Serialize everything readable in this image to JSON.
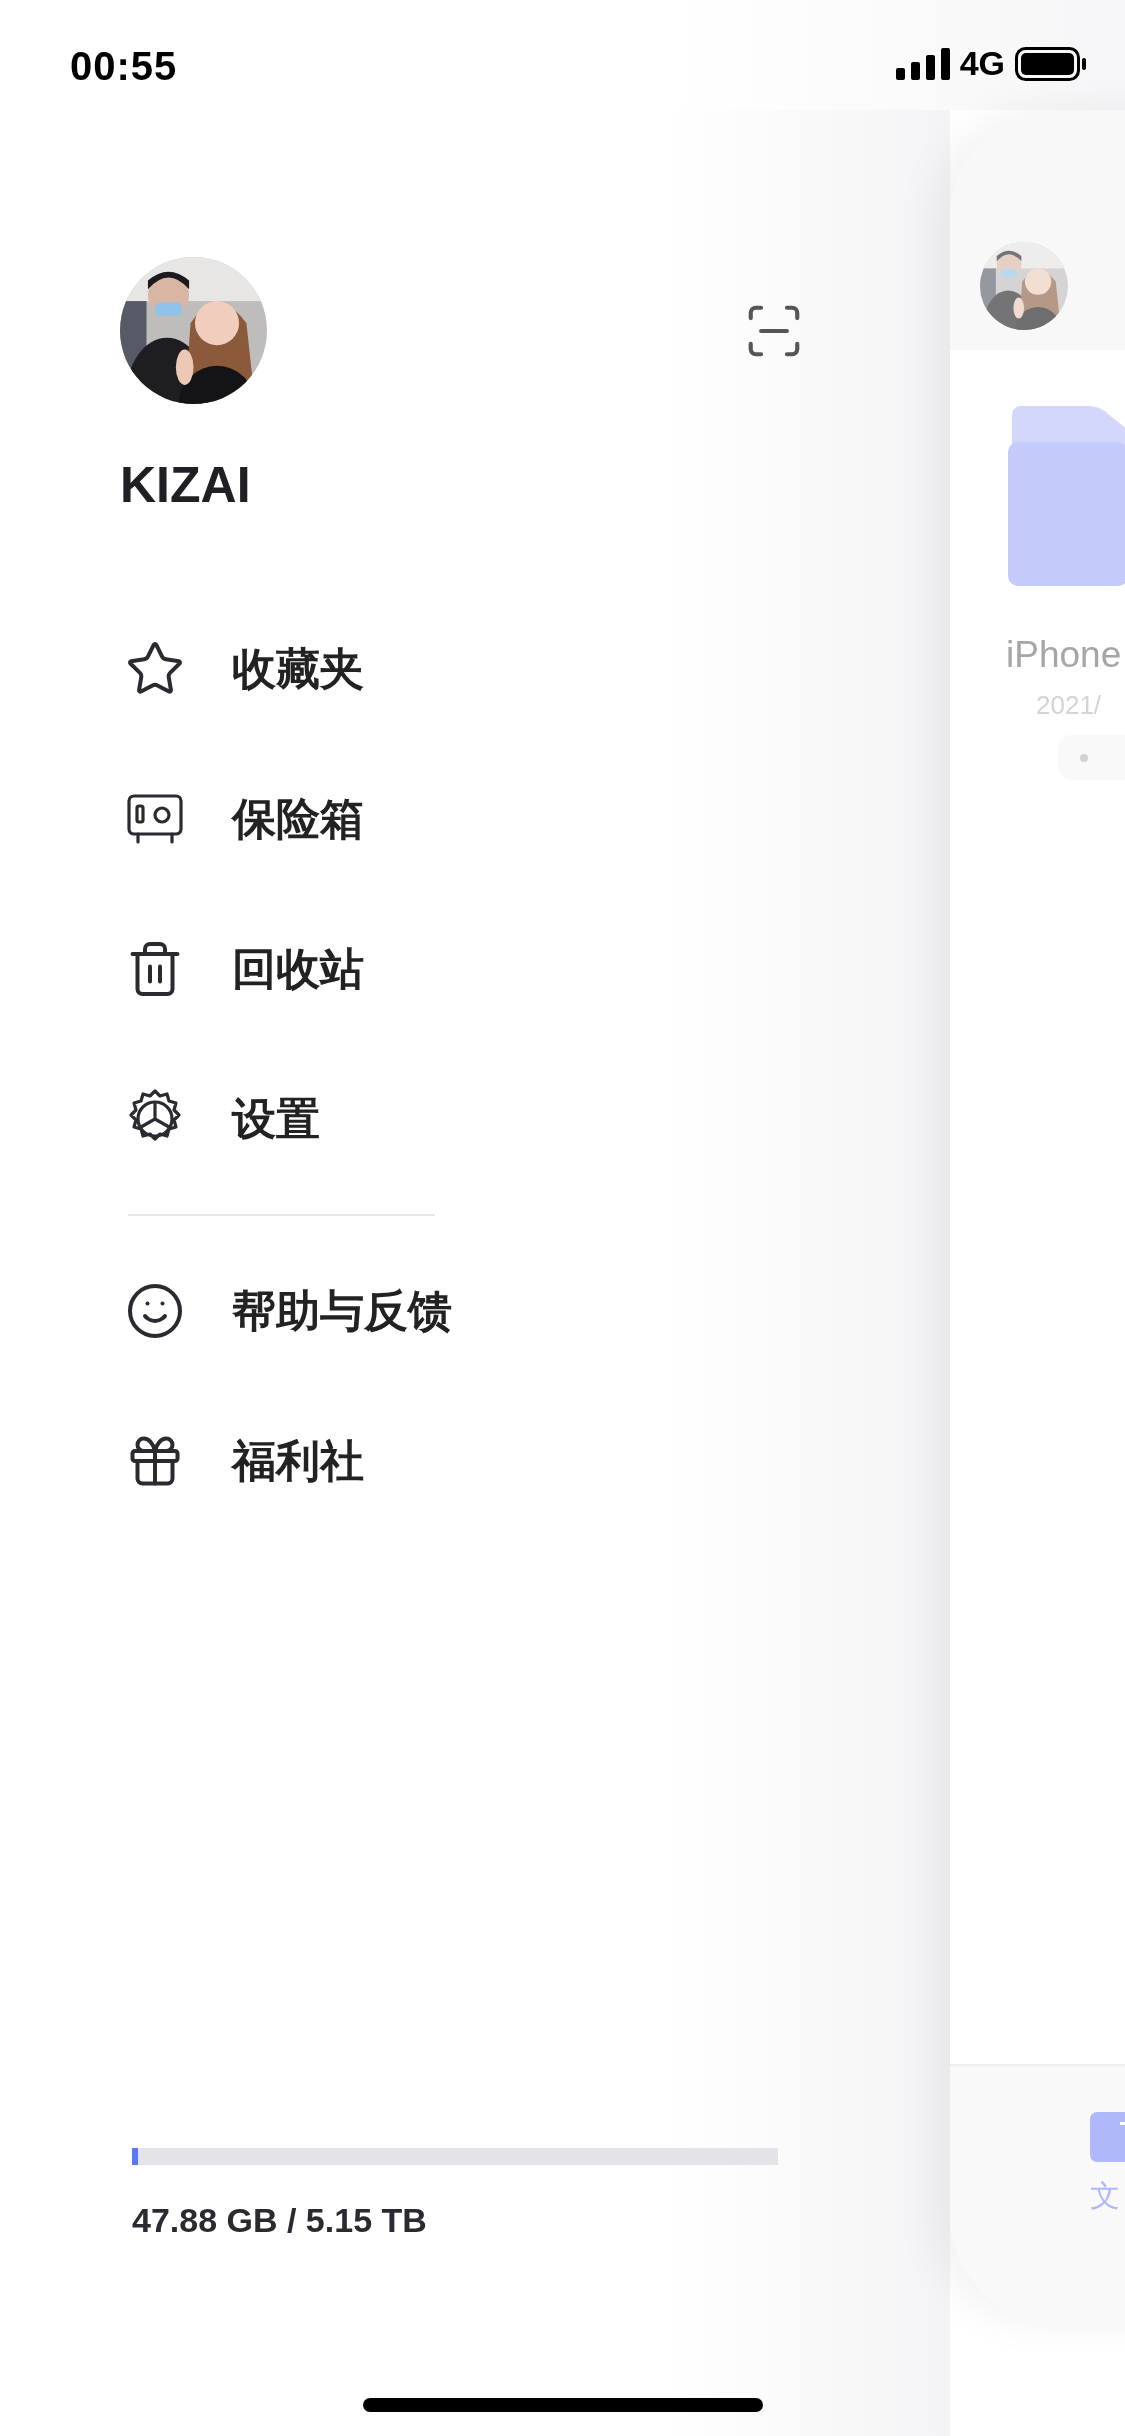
{
  "status_bar": {
    "time": "00:55",
    "network": "4G"
  },
  "profile": {
    "name": "KIZAI"
  },
  "menu_groups": [
    [
      {
        "kind": "star",
        "label": "收藏夹"
      },
      {
        "kind": "safe",
        "label": "保险箱"
      },
      {
        "kind": "trash",
        "label": "回收站"
      },
      {
        "kind": "gear",
        "label": "设置"
      }
    ],
    [
      {
        "kind": "smile",
        "label": "帮助与反馈"
      },
      {
        "kind": "gift",
        "label": "福利社"
      }
    ]
  ],
  "storage": {
    "level": 0.01,
    "reading": "47.88 GB / 5.15 TB"
  },
  "background_screen": {
    "folder": {
      "name": "iPhone",
      "date": "2021/"
    },
    "tab_bar": [
      {
        "label": "文",
        "selected": true
      }
    ]
  }
}
